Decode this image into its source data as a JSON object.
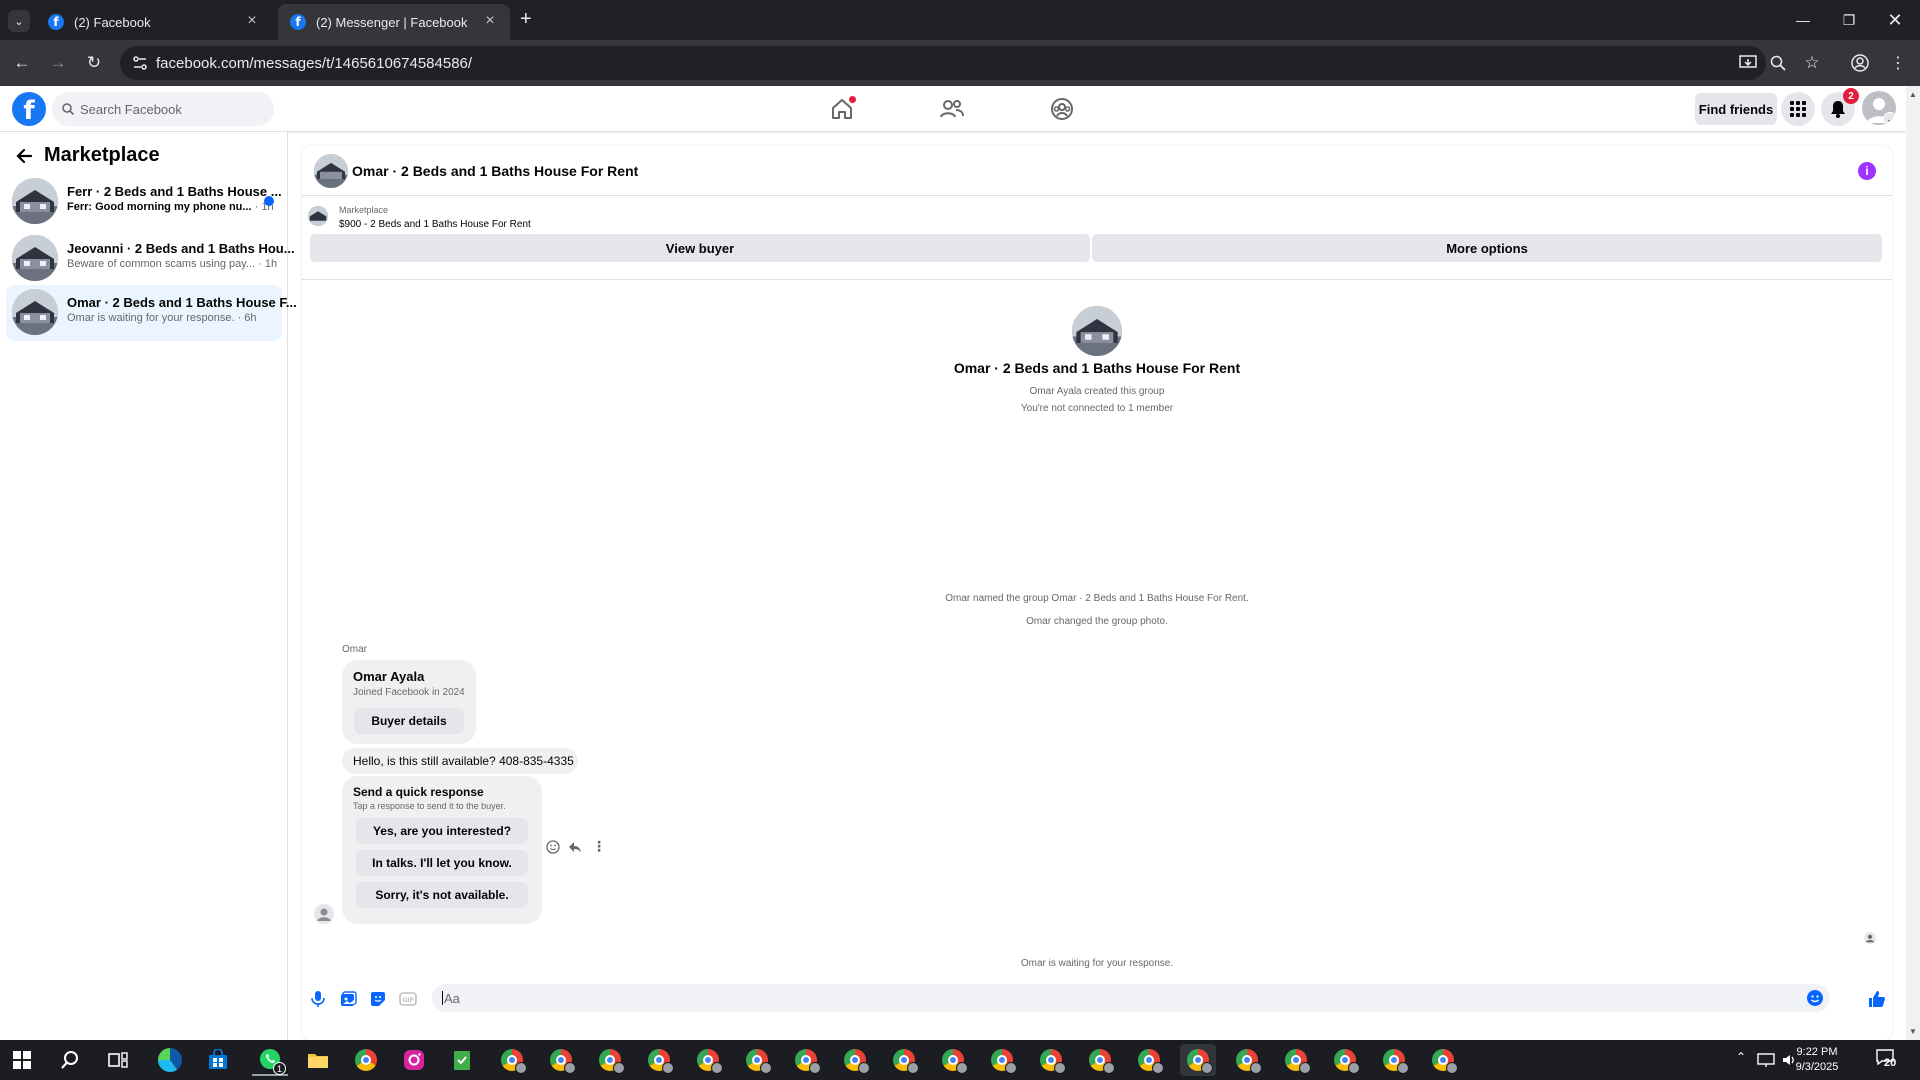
{
  "browser": {
    "tabs": [
      {
        "label": "(2) Facebook",
        "active": false
      },
      {
        "label": "(2) Messenger | Facebook",
        "active": true
      }
    ],
    "new_tab": "+",
    "url": "facebook.com/messages/t/1465610674584586/"
  },
  "facebook": {
    "logo": "f",
    "search_placeholder": "Search Facebook",
    "find_friends": "Find friends",
    "notification_count": "2",
    "accent_color": "#1877f2"
  },
  "sidebar": {
    "title": "Marketplace",
    "conversations": [
      {
        "title": "Ferr · 2 Beds and 1 Baths House ...",
        "preview": "Ferr: Good morning my phone nu...",
        "time": "· 1h",
        "unread": true
      },
      {
        "title": "Jeovanni · 2 Beds and 1 Baths Hou...",
        "preview": "Beware of common scams using pay...",
        "time": "· 1h",
        "unread": false
      },
      {
        "title": "Omar · 2 Beds and 1 Baths House F...",
        "preview": "Omar is waiting for your response.",
        "time": "· 6h",
        "unread": false,
        "active": true
      }
    ]
  },
  "chat": {
    "title": "Omar · 2 Beds and 1 Baths House For Rent",
    "listing": {
      "source": "Marketplace",
      "price_title": "$900 - 2 Beds and 1 Baths House For Rent"
    },
    "view_buyer": "View buyer",
    "more_options": "More options",
    "group": {
      "name": "Omar · 2 Beds and 1 Baths House For Rent",
      "created": "Omar Ayala created this group",
      "connection": "You're not connected to 1 member"
    },
    "system_messages": [
      "Omar named the group Omar · 2 Beds and 1 Baths House For Rent.",
      "Omar changed the group photo."
    ],
    "sender_label": "Omar",
    "buyer_card": {
      "name": "Omar Ayala",
      "joined": "Joined Facebook in 2024",
      "button": "Buyer details"
    },
    "message": "Hello, is this still available? 408-835-4335",
    "quick_response": {
      "title": "Send a quick response",
      "subtitle": "Tap a response to send it to the buyer.",
      "options": [
        "Yes, are you interested?",
        "In talks. I'll let you know.",
        "Sorry, it's not available."
      ]
    },
    "waiting": "Omar is waiting for your response.",
    "composer_placeholder": "Aa"
  },
  "taskbar": {
    "time": "9:22 PM",
    "date": "9/3/2025",
    "whatsapp_badge": "1",
    "notif_count": "20"
  }
}
